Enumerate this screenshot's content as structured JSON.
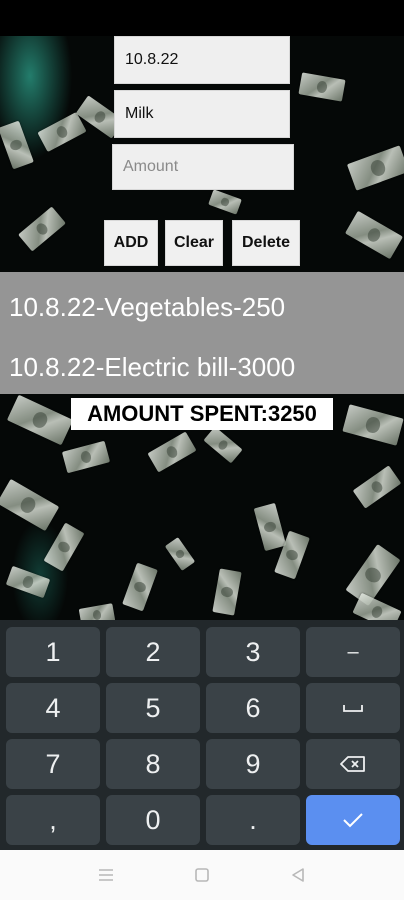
{
  "form": {
    "date_value": "10.8.22",
    "item_value": "Milk",
    "amount_placeholder": "Amount"
  },
  "buttons": {
    "add": "ADD",
    "clear": "Clear",
    "delete": "Delete"
  },
  "expenses": [
    "10.8.22-Vegetables-250",
    "10.8.22-Electric bill-3000"
  ],
  "total_label": "AMOUNT SPENT:3250",
  "keyboard": {
    "rows": [
      [
        "1",
        "2",
        "3",
        "–"
      ],
      [
        "4",
        "5",
        "6",
        "space"
      ],
      [
        "7",
        "8",
        "9",
        "backspace"
      ],
      [
        ",",
        "0",
        ".",
        "enter"
      ]
    ],
    "accent_color": "#5b8ff0"
  },
  "nav": [
    "menu-icon",
    "home-icon",
    "back-icon"
  ]
}
